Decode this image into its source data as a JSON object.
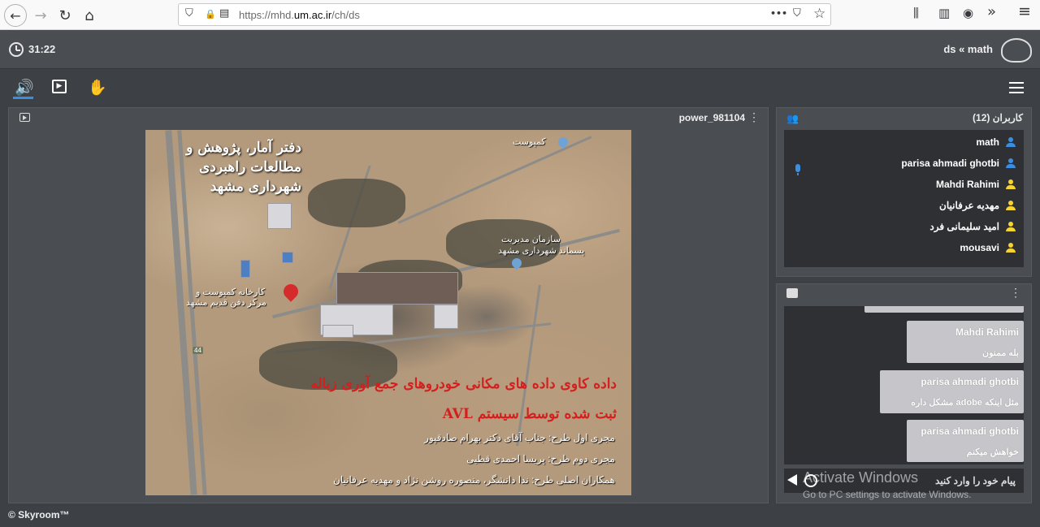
{
  "browser": {
    "url_prefix": "https://mhd.",
    "url_domain": "um.ac.ir",
    "url_path": "/ch/ds",
    "icons": {
      "back": "←",
      "forward": "→",
      "reload": "↻",
      "home": "⌂",
      "shield": "⛉",
      "lock": "🔒",
      "reader": "▤",
      "more": "•••",
      "pocket": "⛉",
      "star": "☆",
      "library": "⫼",
      "sidebar": "▥",
      "account": "◉",
      "overflow": "»",
      "menu": "≡"
    }
  },
  "header": {
    "timer": "31:22",
    "room_title": "ds « math"
  },
  "toolbar": {
    "speaker_icon": "🔊",
    "media_icon": "▶",
    "hand_icon": "✋"
  },
  "presentation": {
    "file_name": "power_981104",
    "more": "⋮",
    "slide": {
      "title_top": "دفتر آمار، پژوهش و مطالعات راهبردی شهرداری مشهد",
      "label_kompost": "کمپوست",
      "label_org_line1": "سازمان مدیریت",
      "label_org_line2": "پسماند شهرداری مشهد",
      "label_factory_line1": "کارخانه کمپوست و",
      "label_factory_line2": "مرکز دفن قدیم مشهد",
      "road_number": "44",
      "heading_line1": "داده کاوی داده های مکانی خودروهای جمع آوری زباله",
      "heading_line2": "ثبت شده توسط سیستم AVL",
      "credit_1": "مجری اول طرح: جناب آقای دکتر بهرام صادقپور",
      "credit_2": "مجری دوم طرح: پریسا احمدی قطبی",
      "credit_3": "همکاران اصلی طرح: ندا دانشگر، منصوره روشن نژاد و مهدیه عرفانیان"
    }
  },
  "users": {
    "title": "کاربران (12)",
    "icon": "👥",
    "items": [
      {
        "name": "math",
        "color": "#3b8fe3"
      },
      {
        "name": "parisa ahmadi ghotbi",
        "color": "#3b8fe3"
      },
      {
        "name": "Mahdi Rahimi",
        "color": "#f5d330"
      },
      {
        "name": "مهدیه عرفانیان",
        "color": "#f5d330"
      },
      {
        "name": "امید سلیمانی فرد",
        "color": "#f5d330"
      },
      {
        "name": "mousavi",
        "color": "#f5d330"
      }
    ]
  },
  "chat": {
    "more": "⋮",
    "messages": [
      {
        "sender": "Mahdi Rahimi",
        "text": "بله ممنون"
      },
      {
        "sender": "parisa ahmadi ghotbi",
        "text": "مثل اینکه adobe مشکل داره"
      },
      {
        "sender": "parisa ahmadi ghotbi",
        "text": "خواهش میکنم"
      }
    ],
    "input_placeholder": "پیام خود را وارد کنید"
  },
  "watermark": {
    "title": "Activate Windows",
    "subtitle": "Go to PC settings to activate Windows."
  },
  "footer": {
    "brand": "© Skyroom™"
  }
}
